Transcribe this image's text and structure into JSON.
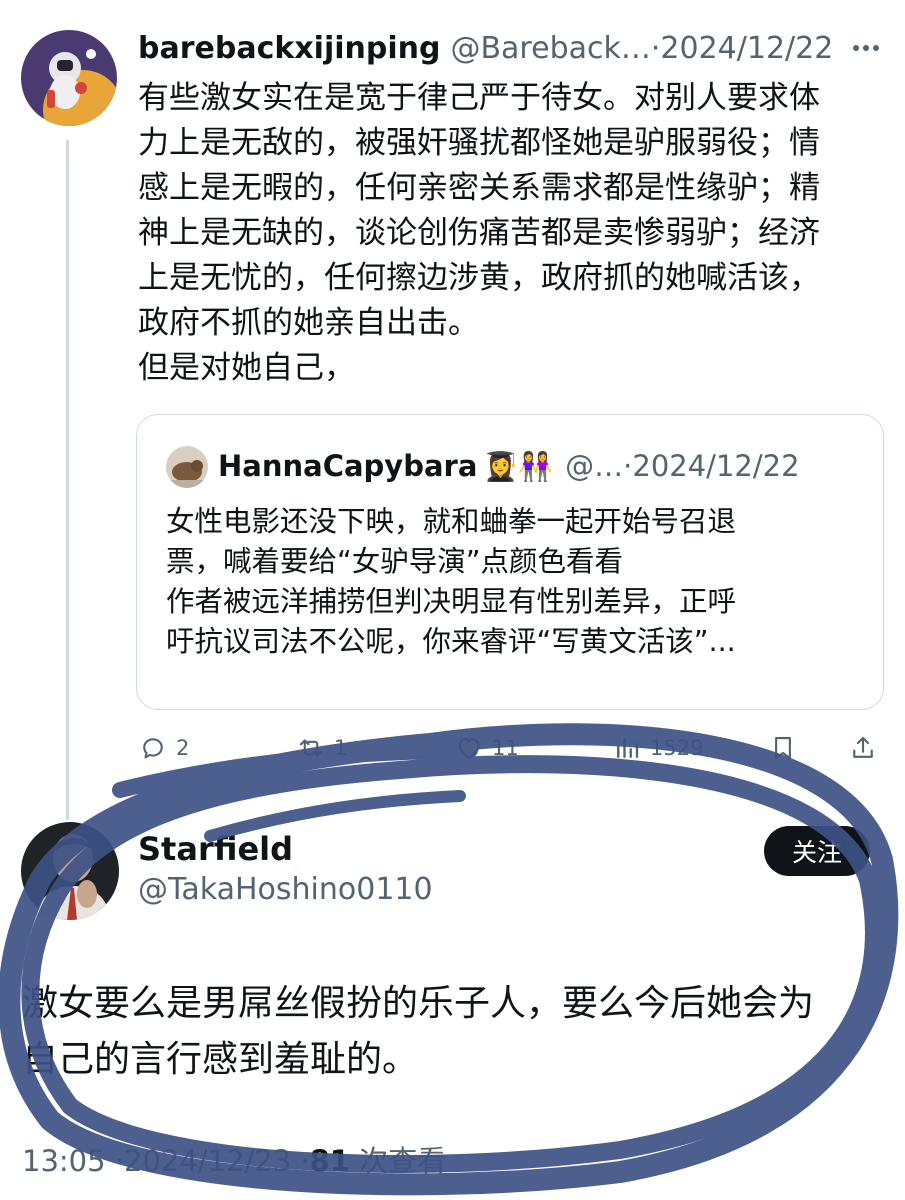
{
  "tweet1": {
    "display_name": "barebackxijinping",
    "handle": "@Bareback…",
    "separator": "·",
    "date": "2024/12/22",
    "lines": [
      "有些激女实在是宽于律己严于待女。对别人要求体",
      "力上是无敌的，被强奸骚扰都怪她是驴服弱役；情",
      "感上是无暇的，任何亲密关系需求都是性缘驴；精",
      "神上是无缺的，谈论创伤痛苦都是卖惨弱驴；经济",
      "上是无忧的，任何擦边涉黄，政府抓的她喊活该，",
      "政府不抓的她亲自出击。",
      "但是对她自己，"
    ],
    "more_icon": "ellipsis-icon"
  },
  "quote": {
    "display_name": "HannaCapybara",
    "emojis": "👩‍🎓👭",
    "handle": "@…",
    "separator": "·",
    "date": "2024/12/22",
    "lines": [
      "女性电影还没下映，就和蛐拳一起开始号召退",
      "票，喊着要给“女驴导演”点颜色看看",
      "作者被远洋捕捞但判决明显有性别差异，正呼",
      "吁抗议司法不公呢，你来睿评“写黄文活该”..."
    ]
  },
  "actions": {
    "replies": "2",
    "retweets": "1",
    "likes": "11",
    "views": "1529"
  },
  "tweet2": {
    "display_name": "Starfield",
    "handle": "@TakaHoshino0110",
    "follow_label": "关注",
    "lines": [
      "激女要么是男屌丝假扮的乐子人，要么今后她会为",
      "自己的言行感到羞耻的。"
    ],
    "time": "13:05",
    "separator": "·",
    "date": "2024/12/23",
    "views_count": "81",
    "views_label": "次查看"
  },
  "colors": {
    "text": "#0f1419",
    "secondary": "#536471",
    "border": "#cfd9de",
    "scribble": "#3d5286"
  }
}
